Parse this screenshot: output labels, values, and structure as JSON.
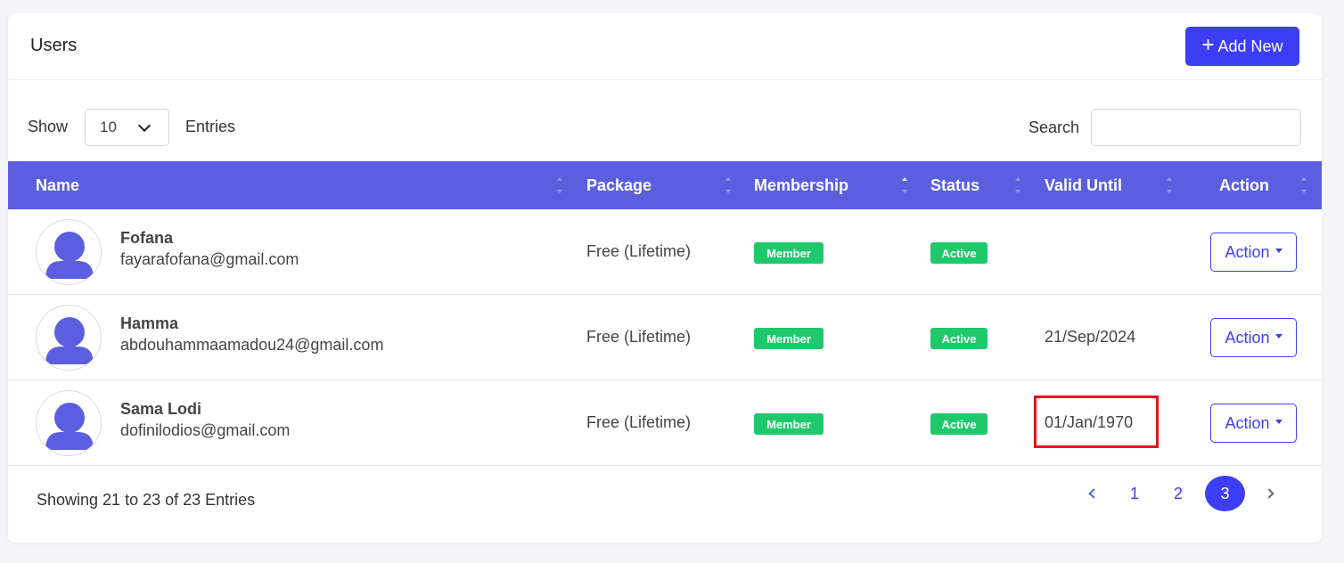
{
  "header": {
    "title": "Users",
    "add_button_label": "Add New"
  },
  "controls": {
    "show_label": "Show",
    "entries_value": "10",
    "entries_label": "Entries",
    "search_label": "Search",
    "search_value": ""
  },
  "table": {
    "columns": [
      "Name",
      "Package",
      "Membership",
      "Status",
      "Valid Until",
      "Action"
    ],
    "rows": [
      {
        "name": "Fofana",
        "email": "fayarafofana@gmail.com",
        "package": "Free (Lifetime)",
        "membership": "Member",
        "status": "Active",
        "valid_until": "",
        "action": "Action"
      },
      {
        "name": "Hamma",
        "email": "abdouhammaamadou24@gmail.com",
        "package": "Free (Lifetime)",
        "membership": "Member",
        "status": "Active",
        "valid_until": "21/Sep/2024",
        "action": "Action"
      },
      {
        "name": "Sama Lodi",
        "email": "dofinilodios@gmail.com",
        "package": "Free (Lifetime)",
        "membership": "Member",
        "status": "Active",
        "valid_until": "01/Jan/1970",
        "action": "Action"
      }
    ]
  },
  "footer": {
    "showing_text": "Showing 21 to 23 of 23 Entries",
    "pages": [
      "1",
      "2",
      "3"
    ],
    "current_page": "3"
  },
  "colors": {
    "accent": "#3b3ef5",
    "table_header": "#5b5fdf",
    "badge_green": "#1fc96b",
    "highlight_red": "#e8121b"
  },
  "icons": {
    "add": "plus-icon",
    "select": "chevron-down-icon",
    "sort": "sort-icon",
    "avatar": "user-avatar-icon",
    "action_caret": "caret-down-icon",
    "prev": "chevron-left-icon",
    "next": "chevron-right-icon"
  }
}
